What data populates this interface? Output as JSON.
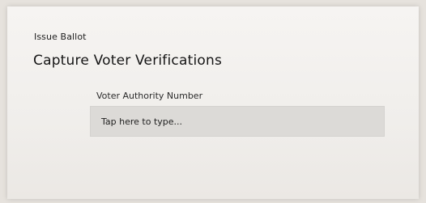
{
  "header": {
    "breadcrumb": "Issue Ballot",
    "title": "Capture Voter Verifications"
  },
  "form": {
    "voter_authority": {
      "label": "Voter Authority Number",
      "value": "",
      "placeholder": "Tap here to type..."
    }
  },
  "colors": {
    "background": "#f4f2ef",
    "input_background": "#dcdad7",
    "text": "#1c1c1c"
  }
}
